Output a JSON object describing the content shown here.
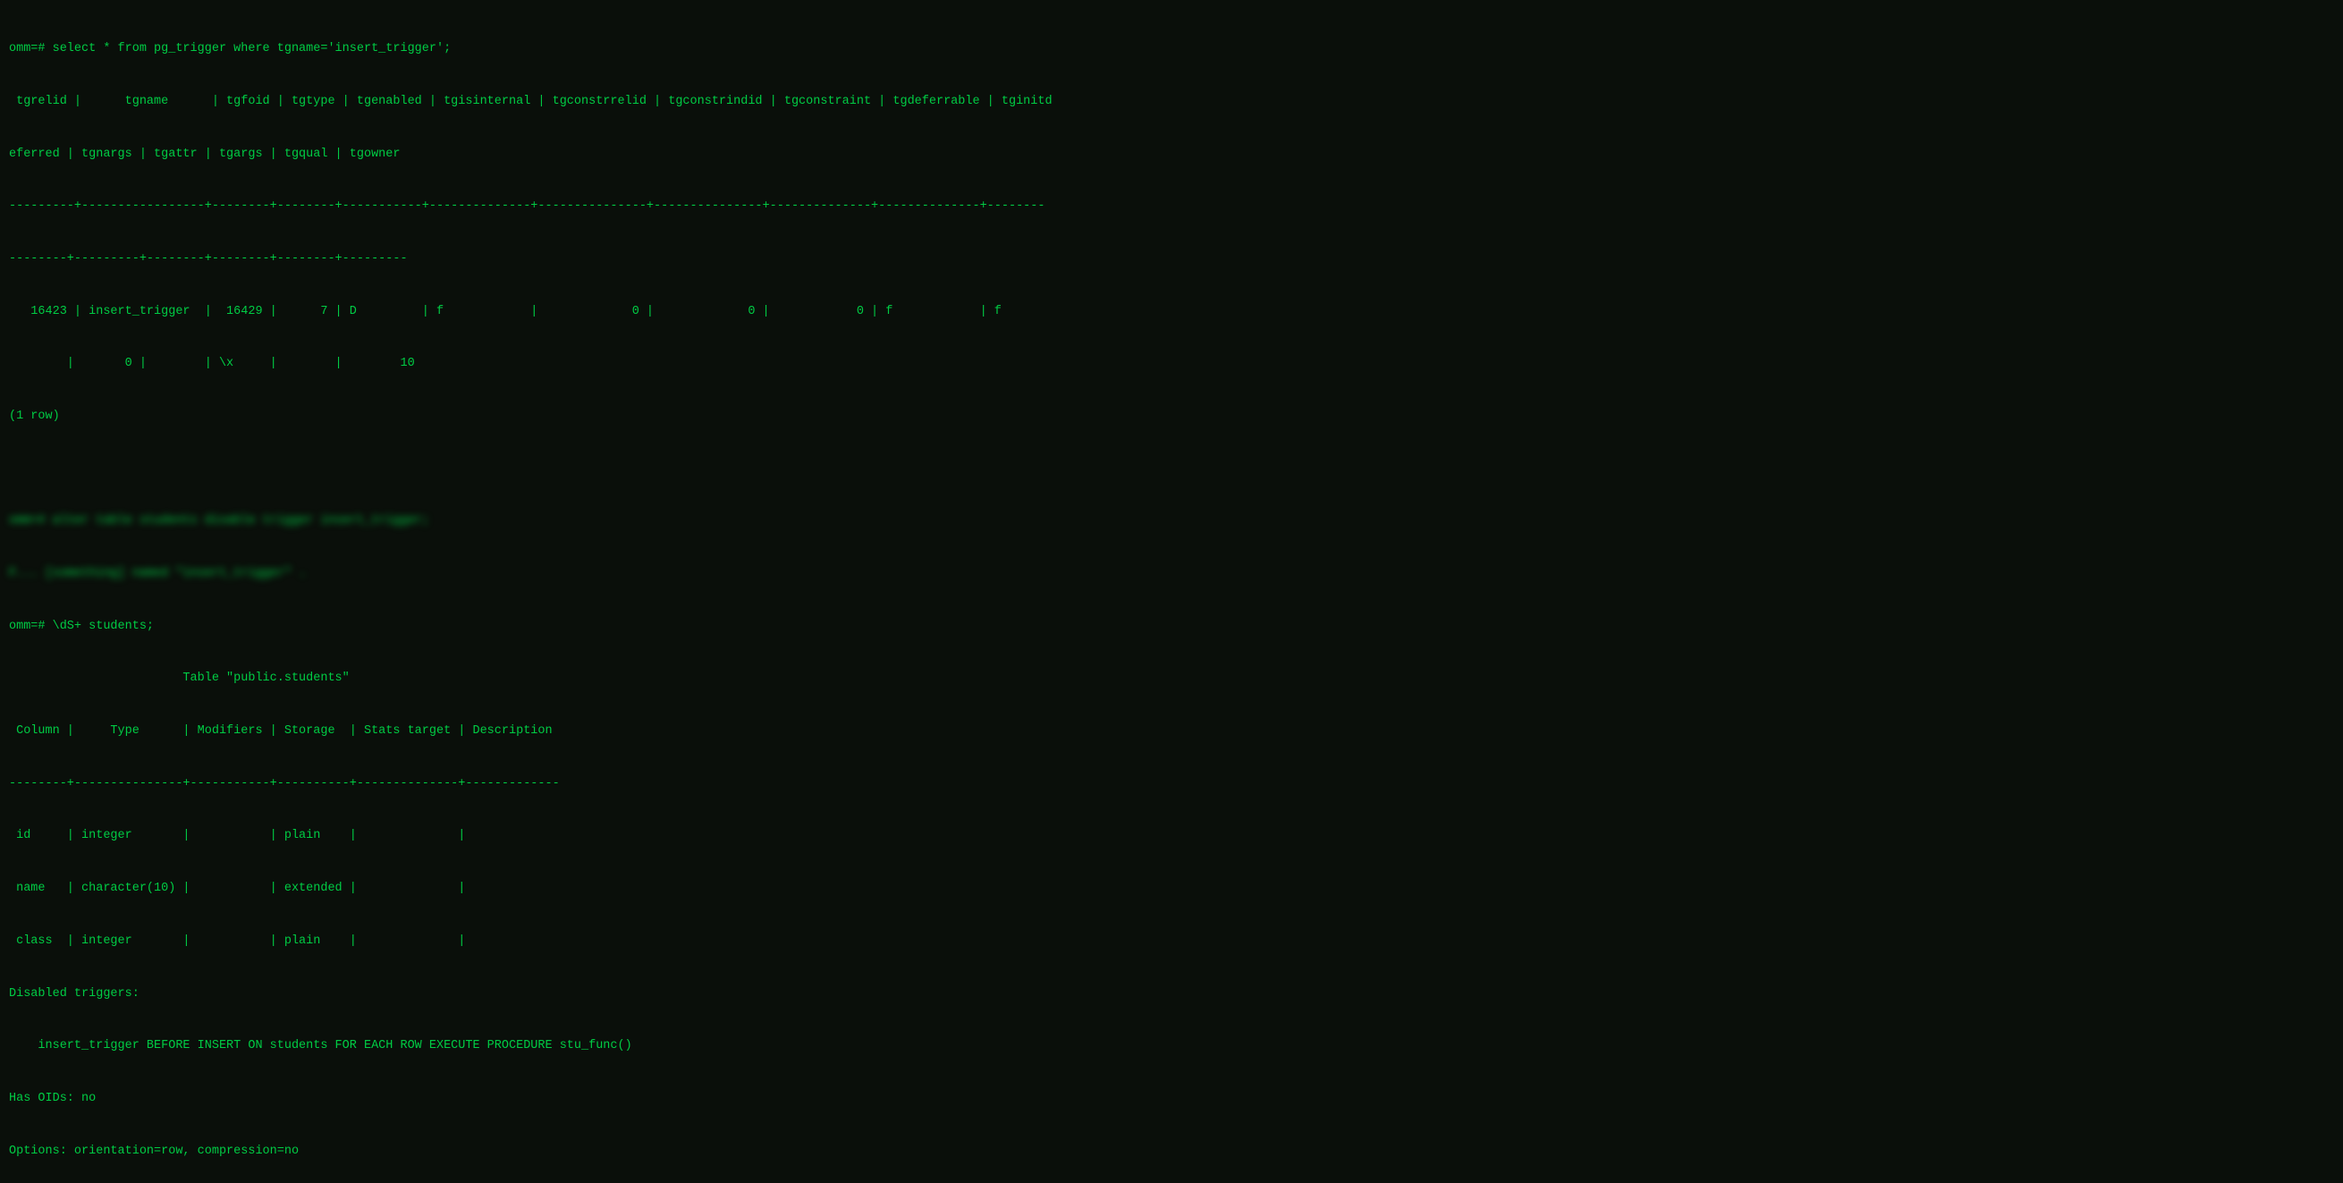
{
  "terminal": {
    "lines": [
      {
        "id": "l1",
        "text": "omm=# select * from pg_trigger where tgname='insert_trigger';"
      },
      {
        "id": "l2",
        "text": " tgrelid |      tgname      | tgfoid | tgtype | tgenabled | tgisinternal | tgconstrrelid | tgconstrindid | tgconstraint | tgdeferrable | tginitd"
      },
      {
        "id": "l3",
        "text": "eferred | tgnargs | tgattr | tgargs | tgqual | tgowner"
      },
      {
        "id": "l4",
        "text": "---------+-----------------+--------+--------+-----------+--------------+---------------+---------------+--------------+--------------+--------"
      },
      {
        "id": "l5",
        "text": "--------+---------+--------+--------+--------+---------"
      },
      {
        "id": "l6",
        "text": "   16423 | insert_trigger  |  16429 |      7 | D         | f            |             0 |             0 |            0 | f            | f"
      },
      {
        "id": "l7",
        "text": "        |       0 |        | \\x     |        |        10"
      },
      {
        "id": "l8",
        "text": "(1 row)"
      },
      {
        "id": "l9",
        "text": ""
      },
      {
        "id": "l10",
        "text": "BLURRED_LINE_1",
        "blurred": true,
        "blurred_text": "omm=# alter table students"
      },
      {
        "id": "l11",
        "text": "BLURRED_LINE_2",
        "blurred": true,
        "blurred_text": "F... [some text] named \"insert_trigger\" ."
      },
      {
        "id": "l12",
        "text": "omm=# \\dS+ students;"
      },
      {
        "id": "l13",
        "text": "                        Table \"public.students\""
      },
      {
        "id": "l14",
        "text": " Column |     Type      | Modifiers | Storage  | Stats target | Description"
      },
      {
        "id": "l15",
        "text": "--------+---------------+-----------+----------+--------------+-------------"
      },
      {
        "id": "l16",
        "text": " id     | integer       |           | plain    |              |"
      },
      {
        "id": "l17",
        "text": " name   | character(10) |           | extended |              |"
      },
      {
        "id": "l18",
        "text": " class  | integer       |           | plain    |              |"
      },
      {
        "id": "l19",
        "text": "Disabled triggers:"
      },
      {
        "id": "l20",
        "text": "    insert_trigger BEFORE INSERT ON students FOR EACH ROW EXECUTE PROCEDURE stu_func()"
      },
      {
        "id": "l21",
        "text": "Has OIDs: no"
      },
      {
        "id": "l22",
        "text": "Options: orientation=row, compression=no"
      }
    ]
  }
}
